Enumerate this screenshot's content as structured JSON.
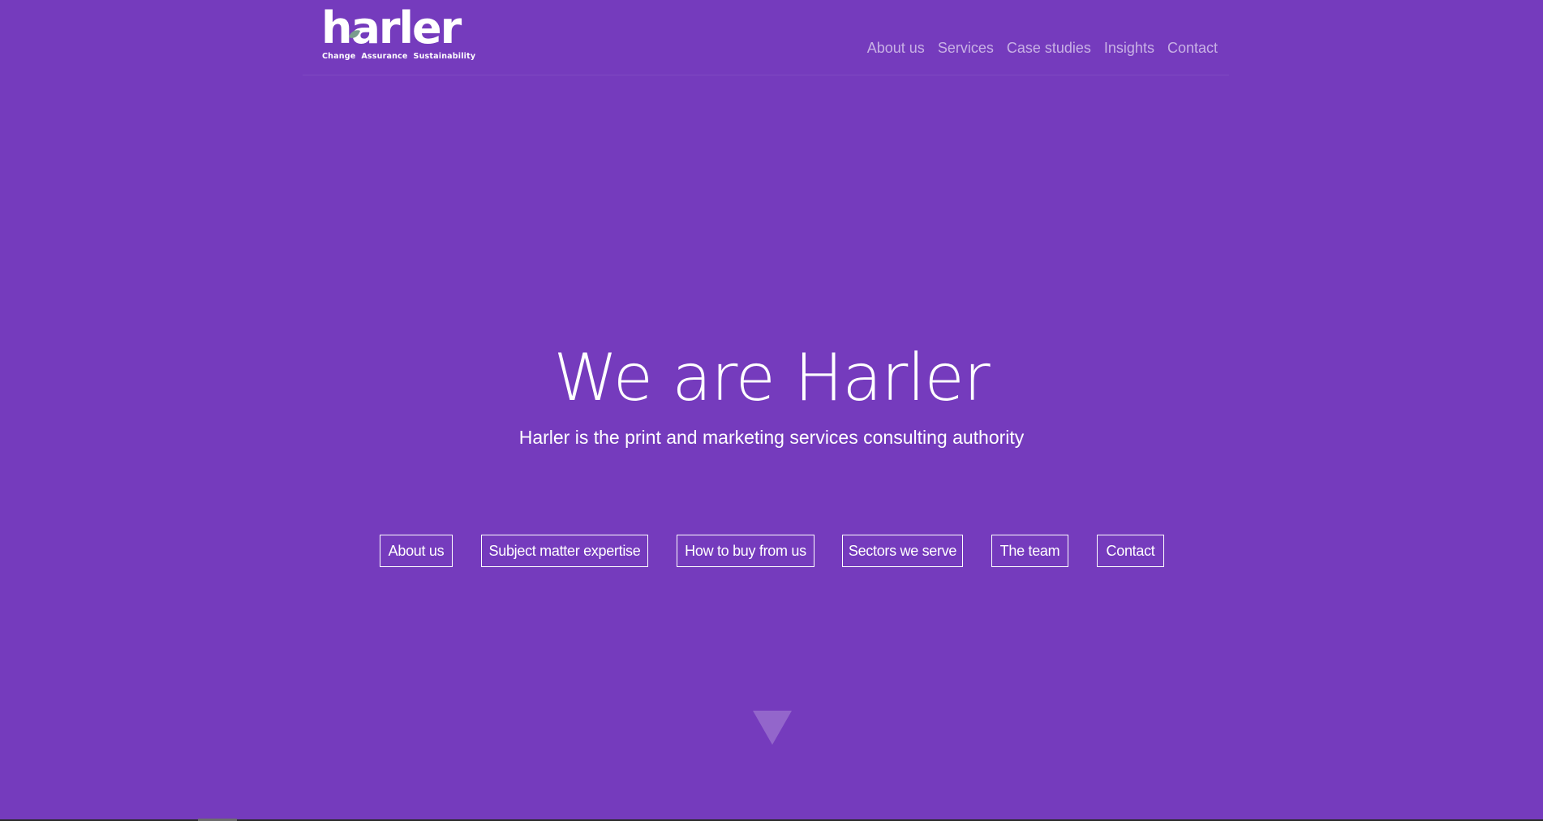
{
  "logo": {
    "word": "harler",
    "tagline": [
      "Change",
      "Assurance",
      "Sustainability"
    ]
  },
  "nav": {
    "items": [
      "About us",
      "Services",
      "Case studies",
      "Insights",
      "Contact"
    ]
  },
  "hero": {
    "title": "We are Harler",
    "subtitle": "Harler is the print and marketing services consulting authority"
  },
  "quick_links": [
    "About us",
    "Subject matter expertise",
    "How to buy from us",
    "Sectors we serve",
    "The team",
    "Contact"
  ],
  "colors": {
    "background": "#753bbd",
    "text": "#ffffff",
    "nav_text": "rgba(255,255,255,0.6)",
    "leaf_accent": "#7a9c8e"
  },
  "icons": {
    "scroll": "triangle-down-icon",
    "logo_leaf": "leaf-icon"
  }
}
